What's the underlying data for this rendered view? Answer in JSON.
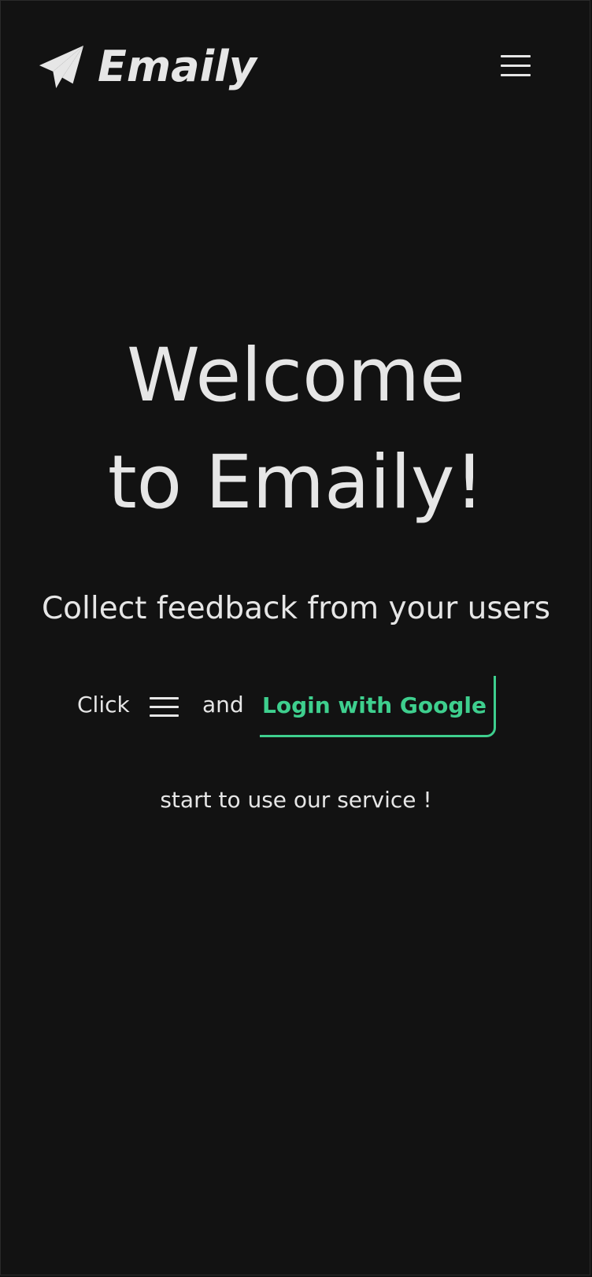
{
  "navbar": {
    "brand": {
      "icon": "paper-plane-icon",
      "name": "Emaily"
    },
    "menu_icon": "hamburger-menu-icon"
  },
  "hero": {
    "title_line1": "Welcome",
    "title_line2": "to Emaily!",
    "subtitle": "Collect feedback from your users"
  },
  "cta": {
    "click_text": "Click",
    "menu_icon": "hamburger-menu-icon",
    "and_text": "and",
    "login_button_label": "Login with Google",
    "tail_text": "start to use our service !"
  },
  "colors": {
    "background": "#121212",
    "text": "#e6e6e6",
    "accent": "#3ecf8e"
  }
}
